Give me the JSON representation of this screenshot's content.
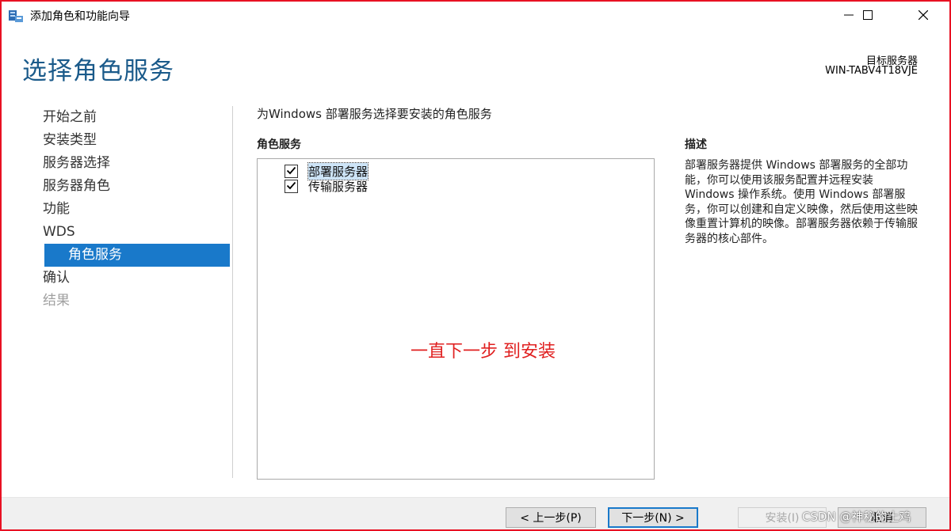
{
  "window": {
    "title": "添加角色和功能向导",
    "icon": "server-manager-icon",
    "controls": [
      "minimize-icon",
      "maximize-icon",
      "close-icon"
    ]
  },
  "header": {
    "page_title": "选择角色服务",
    "target_label": "目标服务器",
    "target_name": "WIN-TABV4T18VJE"
  },
  "nav": {
    "items": [
      {
        "label": "开始之前",
        "state": "normal"
      },
      {
        "label": "安装类型",
        "state": "normal"
      },
      {
        "label": "服务器选择",
        "state": "normal"
      },
      {
        "label": "服务器角色",
        "state": "normal"
      },
      {
        "label": "功能",
        "state": "normal"
      },
      {
        "label": "WDS",
        "state": "normal"
      },
      {
        "label": "角色服务",
        "state": "active"
      },
      {
        "label": "确认",
        "state": "normal"
      },
      {
        "label": "结果",
        "state": "disabled"
      }
    ]
  },
  "main": {
    "intro": "为Windows 部署服务选择要安装的角色服务",
    "list_title": "角色服务",
    "services": [
      {
        "label": "部署服务器",
        "checked": true,
        "selected": true
      },
      {
        "label": "传输服务器",
        "checked": true,
        "selected": false
      }
    ],
    "annotation": "一直下一步 到安装"
  },
  "description": {
    "title": "描述",
    "text": "部署服务器提供 Windows 部署服务的全部功能，你可以使用该服务配置并远程安装 Windows 操作系统。使用 Windows 部署服务，你可以创建和自定义映像，然后使用这些映像重置计算机的映像。部署服务器依赖于传输服务器的核心部件。"
  },
  "footer": {
    "prev": "< 上一步(P)",
    "next": "下一步(N) >",
    "install": "安装(I)",
    "cancel": "取消",
    "watermark": "CSDN @神秘的土鸡"
  },
  "colors": {
    "accent": "#1979ca",
    "title": "#1a5a8a",
    "annotation": "#e02020",
    "frame": "#e81123"
  }
}
